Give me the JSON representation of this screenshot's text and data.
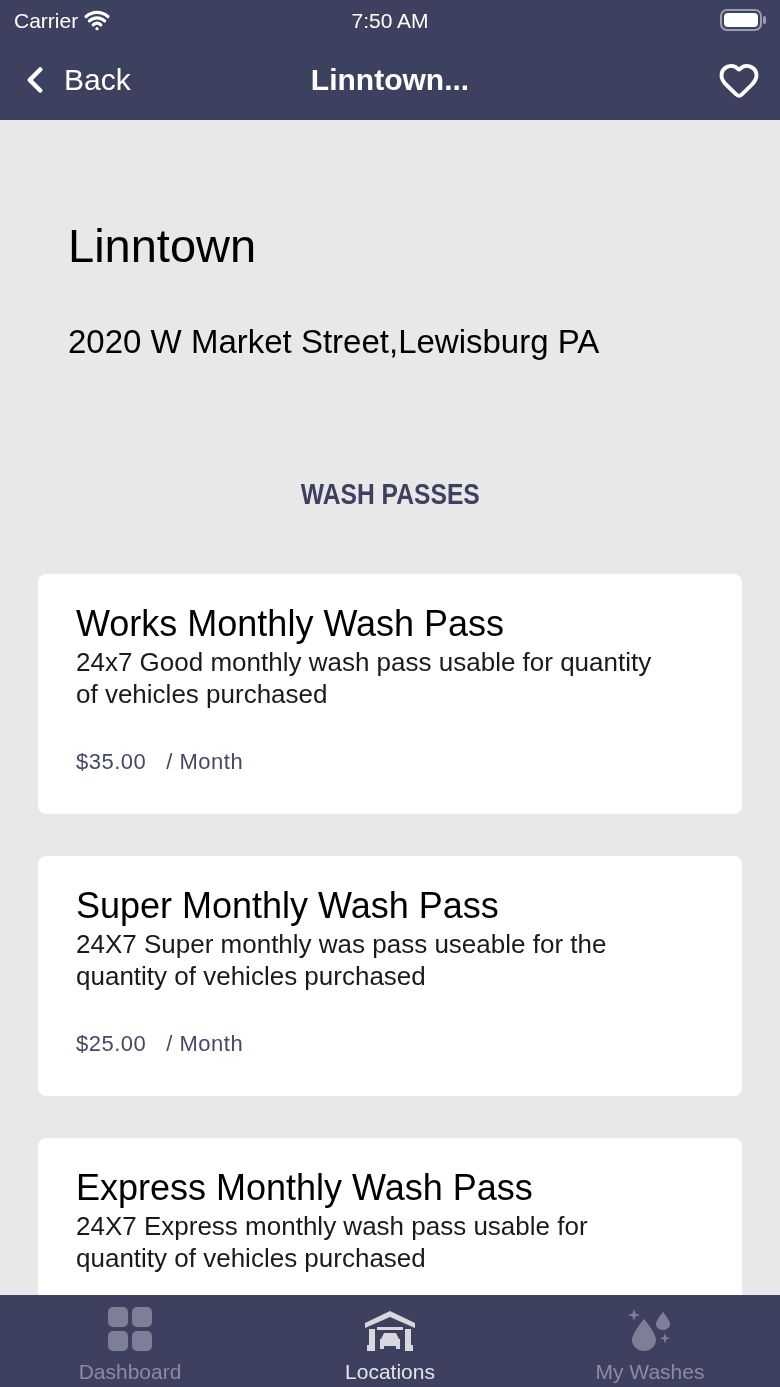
{
  "status_bar": {
    "carrier": "Carrier",
    "time": "7:50 AM"
  },
  "nav_bar": {
    "back": "Back",
    "title": "Linntown...",
    "favorited": false
  },
  "location": {
    "name": "Linntown",
    "address": "2020 W Market Street,Lewisburg PA"
  },
  "section_title": "WASH PASSES",
  "passes": [
    {
      "title": "Works Monthly Wash Pass",
      "description": "24x7 Good monthly wash pass usable for quantity of vehicles purchased",
      "price": "$35.00",
      "period": "/ Month"
    },
    {
      "title": "Super Monthly Wash Pass",
      "description": "24X7 Super monthly was pass useable for the quantity of vehicles purchased",
      "price": "$25.00",
      "period": "/ Month"
    },
    {
      "title": "Express Monthly Wash Pass",
      "description": "24X7 Express monthly wash pass usable for quantity of vehicles purchased"
    }
  ],
  "tab_bar": [
    {
      "kind": "grid",
      "label": "Dashboard",
      "selected": false
    },
    {
      "kind": "garage",
      "label": "Locations",
      "selected": true
    },
    {
      "kind": "drops",
      "label": "My Washes",
      "selected": false
    }
  ]
}
